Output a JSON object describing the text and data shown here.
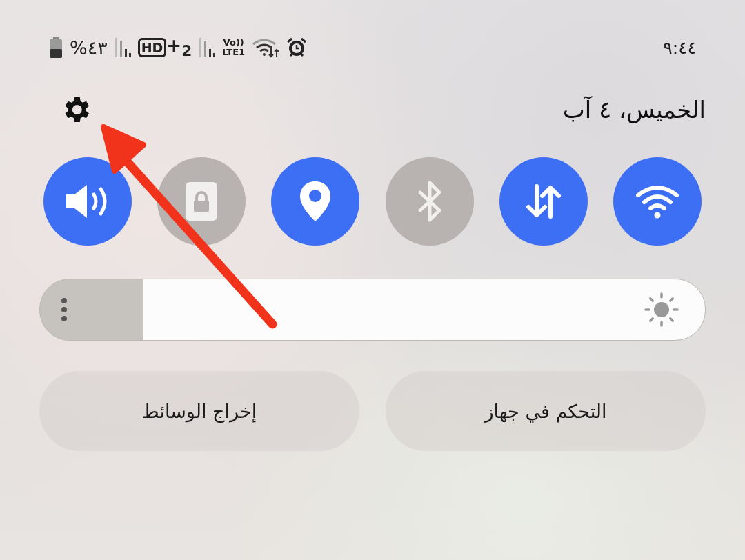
{
  "status_bar": {
    "time": "٩:٤٤",
    "battery_percent": "%٤٣",
    "hd_label": "HD",
    "hd_extra": "+$_{2}$",
    "volte_top": "Vo))",
    "volte_bottom": "LTE1"
  },
  "header": {
    "date": "الخميس، ٤ آب"
  },
  "toggles": [
    {
      "kind": "wifi",
      "on": true
    },
    {
      "kind": "data",
      "on": true
    },
    {
      "kind": "bluetooth",
      "on": false
    },
    {
      "kind": "location",
      "on": true
    },
    {
      "kind": "lock",
      "on": false
    },
    {
      "kind": "sound",
      "on": true
    }
  ],
  "brightness": {
    "level": 0.845
  },
  "buttons": [
    {
      "label": "التحكم في جهاز"
    },
    {
      "label": "إخراج الوسائط"
    }
  ]
}
